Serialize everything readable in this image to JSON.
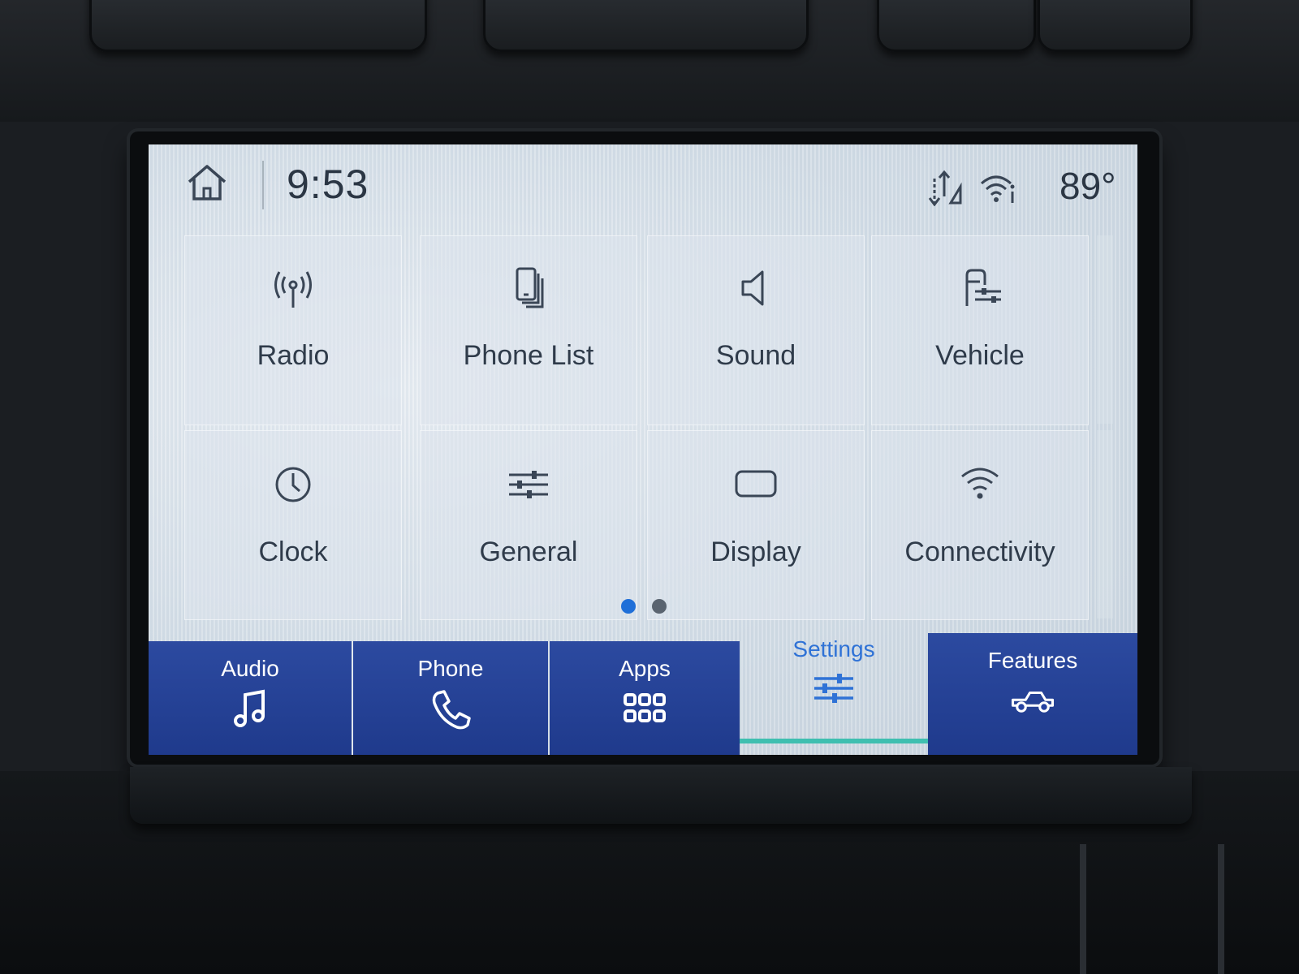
{
  "status_bar": {
    "time": "9:53",
    "temperature": "89°",
    "icons": [
      "home-icon",
      "sync-icon",
      "wifi-icon"
    ]
  },
  "tiles": [
    {
      "label": "Radio",
      "icon": "antenna-icon"
    },
    {
      "label": "Phone List",
      "icon": "phones-icon"
    },
    {
      "label": "Sound",
      "icon": "speaker-icon"
    },
    {
      "label": "Vehicle",
      "icon": "vehicle-settings-icon"
    },
    {
      "label": "Clock",
      "icon": "clock-icon"
    },
    {
      "label": "General",
      "icon": "sliders-icon"
    },
    {
      "label": "Display",
      "icon": "screen-icon"
    },
    {
      "label": "Connectivity",
      "icon": "wifi-icon"
    }
  ],
  "pagination": {
    "current": 1,
    "total": 2,
    "active_color": "#1f6fd8",
    "inactive_color": "#5a6470"
  },
  "nav": [
    {
      "label": "Audio",
      "icon": "music-note-icon"
    },
    {
      "label": "Phone",
      "icon": "phone-handset-icon"
    },
    {
      "label": "Apps",
      "icon": "apps-grid-icon"
    },
    {
      "label": "Settings",
      "icon": "sliders-icon",
      "active": true
    },
    {
      "label": "Features",
      "icon": "truck-icon"
    }
  ],
  "colors": {
    "nav_bg": "#2542a0",
    "active_label": "#2f72d6",
    "active_underline": "#3fbfb0"
  }
}
